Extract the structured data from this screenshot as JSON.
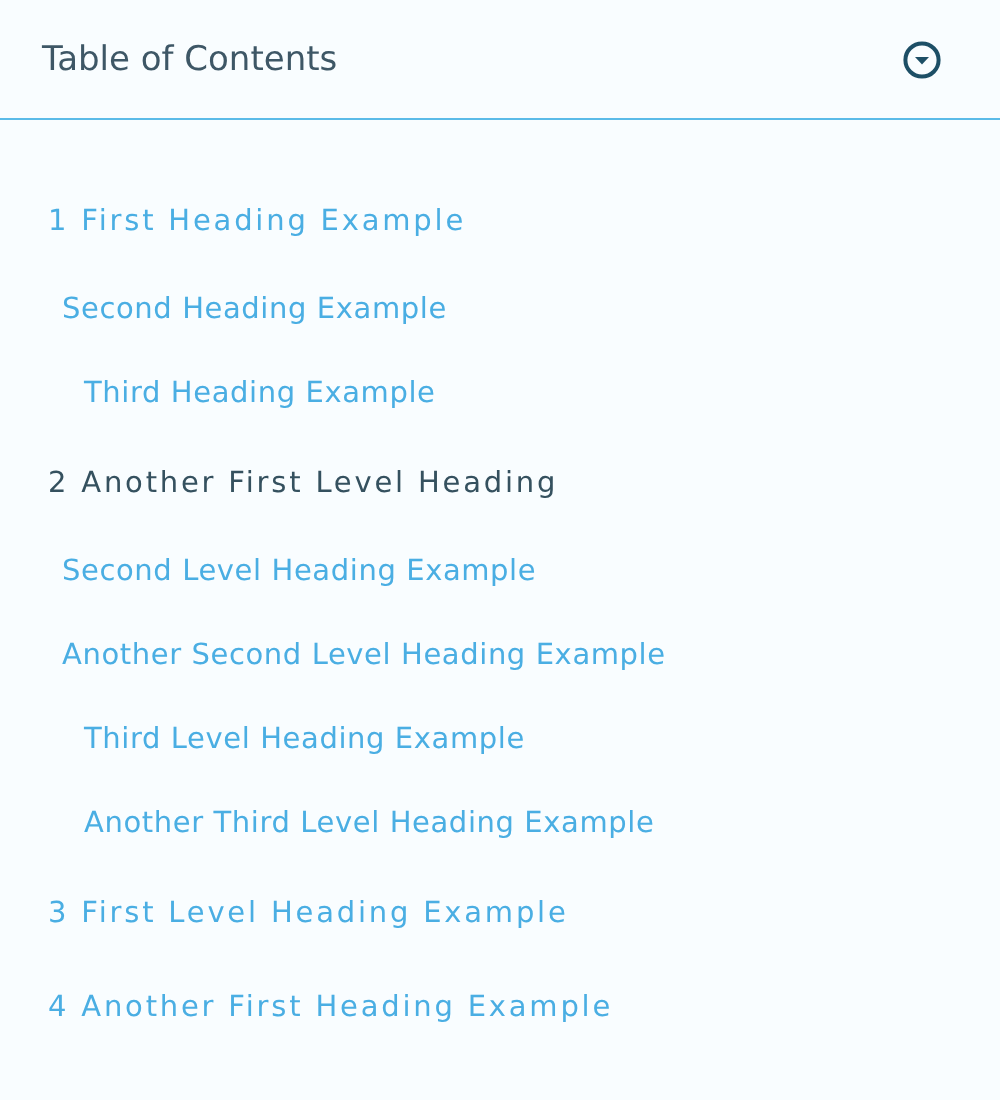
{
  "title": "Table of Contents",
  "items": [
    {
      "label": "1 First Heading Example",
      "selected": false,
      "children": [
        {
          "label": "Second Heading Example",
          "selected": false,
          "children": [
            {
              "label": "Third Heading Example",
              "selected": false
            }
          ]
        }
      ]
    },
    {
      "label": "2 Another First Level Heading",
      "selected": true,
      "children": [
        {
          "label": "Second Level Heading Example",
          "selected": false
        },
        {
          "label": "Another Second Level Heading Example",
          "selected": false,
          "children": [
            {
              "label": "Third Level Heading Example",
              "selected": false
            },
            {
              "label": "Another Third Level Heading Example",
              "selected": false
            }
          ]
        }
      ]
    },
    {
      "label": "3 First Level Heading Example",
      "selected": false
    },
    {
      "label": "4 Another First Heading Example",
      "selected": false
    }
  ]
}
